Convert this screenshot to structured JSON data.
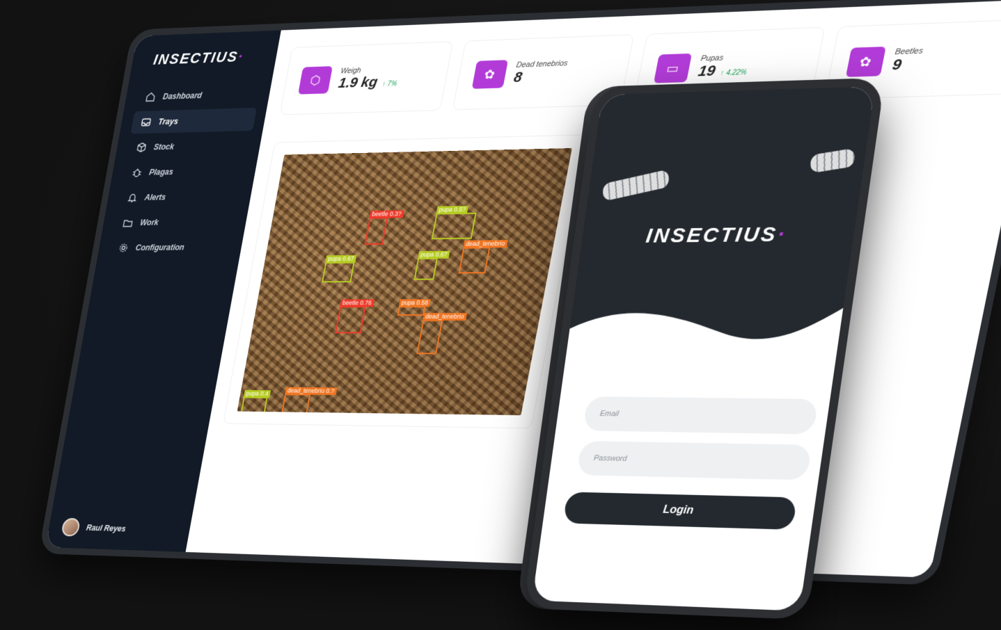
{
  "brand": {
    "name": "INSECTIUS",
    "accent": "#b93ad8"
  },
  "sidebar": {
    "items": [
      {
        "label": "Dashboard",
        "icon": "home-icon"
      },
      {
        "label": "Trays",
        "icon": "tray-icon",
        "active": true
      },
      {
        "label": "Stock",
        "icon": "box-icon"
      },
      {
        "label": "Plagas",
        "icon": "bug-icon"
      },
      {
        "label": "Alerts",
        "icon": "bell-icon"
      },
      {
        "label": "Work",
        "icon": "folder-icon"
      },
      {
        "label": "Configuration",
        "icon": "gear-icon"
      }
    ],
    "user": {
      "name": "Raul Reyes"
    }
  },
  "stats": [
    {
      "label": "Weigh",
      "value": "1.9 kg",
      "delta": "↑ 7%",
      "icon": "cube-icon"
    },
    {
      "label": "Dead tenebrios",
      "value": "8",
      "delta": "",
      "icon": "bug-icon"
    },
    {
      "label": "Pupas",
      "value": "19",
      "delta": "↑ 4.22%",
      "icon": "video-icon"
    },
    {
      "label": "Beetles",
      "value": "9",
      "delta": "",
      "icon": "bug-icon"
    }
  ],
  "detections": [
    {
      "label": "beetle 0.3?",
      "color": "#ee3b2a"
    },
    {
      "label": "pupa 0.5?",
      "color": "#b6cc22"
    },
    {
      "label": "dead_tenebrio",
      "color": "#f07522"
    },
    {
      "label": "pupa 0.67",
      "color": "#b6cc22"
    },
    {
      "label": "pupa 0.67",
      "color": "#b6cc22"
    },
    {
      "label": "beetle 0.76",
      "color": "#ee3b2a"
    },
    {
      "label": "pupa 0.58",
      "color": "#f07522"
    },
    {
      "label": "dead_tenebrio",
      "color": "#f07522"
    },
    {
      "label": "pupa 0.4",
      "color": "#b6cc22"
    },
    {
      "label": "dead_tenebrio 0.?",
      "color": "#f07522"
    }
  ],
  "phone": {
    "logo": "INSECTIUS",
    "email_placeholder": "Email",
    "password_placeholder": "Password",
    "login_label": "Login"
  }
}
